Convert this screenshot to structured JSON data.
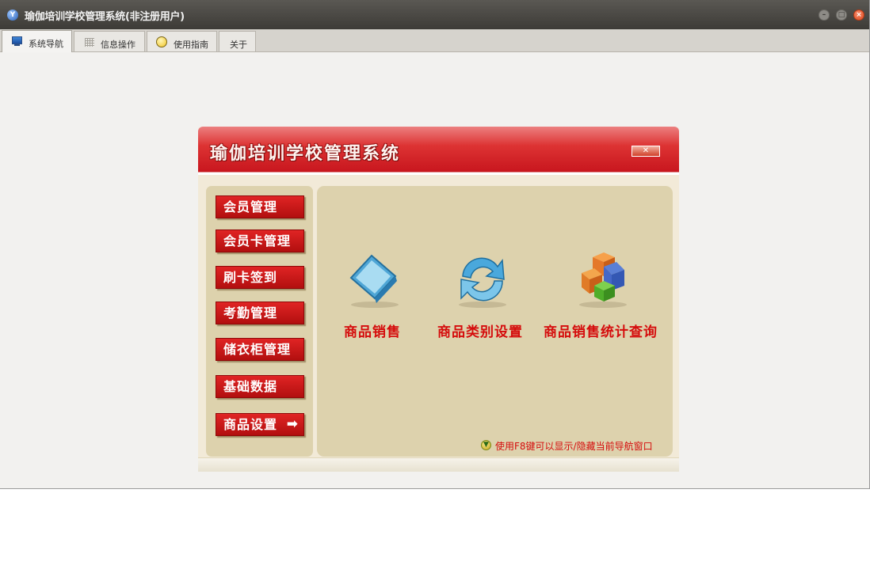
{
  "window": {
    "title": "瑜伽培训学校管理系统(非注册用户)"
  },
  "tabs": [
    {
      "label": "系统导航",
      "icon": "monitor-icon"
    },
    {
      "label": "信息操作",
      "icon": "grid-icon"
    },
    {
      "label": "使用指南",
      "icon": "help-icon"
    },
    {
      "label": "关于"
    }
  ],
  "panel": {
    "title": "瑜伽培训学校管理系统",
    "close_label": "✕",
    "menu": [
      {
        "label": "会员管理"
      },
      {
        "label": "会员卡管理"
      },
      {
        "label": "刷卡签到"
      },
      {
        "label": "考勤管理"
      },
      {
        "label": "储衣柜管理"
      },
      {
        "label": "基础数据"
      },
      {
        "label": "商品设置",
        "arrow": "➡",
        "selected": true
      }
    ],
    "features": [
      {
        "label": "商品销售",
        "icon": "monitor-product-icon"
      },
      {
        "label": "商品类别设置",
        "icon": "refresh-icon"
      },
      {
        "label": "商品销售统计查询",
        "icon": "cubes-icon"
      }
    ],
    "hint": "使用F8键可以显示/隐藏当前导航窗口"
  },
  "colors": {
    "accent_red": "#d50c0c",
    "header_red": "#dd3333",
    "panel_beige": "#ddd2ad"
  }
}
